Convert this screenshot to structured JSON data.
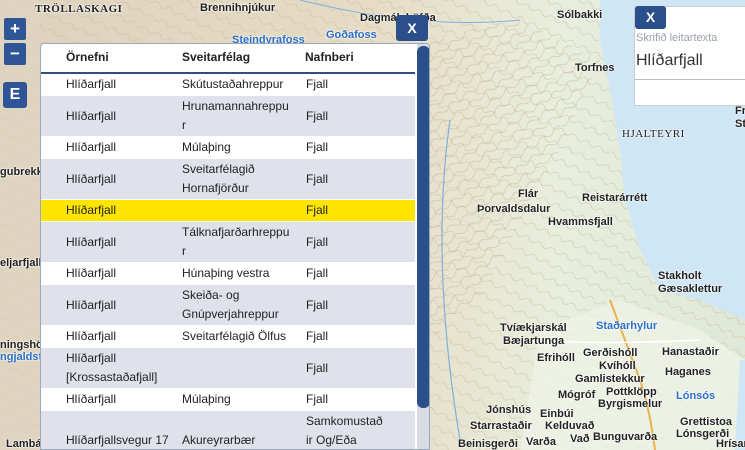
{
  "map": {
    "places": [
      {
        "name": "TRÖLLASKAGI",
        "style": "bold serif"
      },
      {
        "name": "Brennihnjúkur",
        "style": ""
      },
      {
        "name": "Dagmálahöfða",
        "style": ""
      },
      {
        "name": "Goðafoss",
        "style": "water"
      },
      {
        "name": "Steindyrafoss",
        "style": "water"
      },
      {
        "name": "Sólbakki",
        "style": "bold"
      },
      {
        "name": "Torfnes",
        "style": "bold"
      },
      {
        "name": "HJALTEYRI",
        "style": "serif"
      },
      {
        "name": "Flár",
        "style": "bold"
      },
      {
        "name": "Þorvaldsdalur",
        "style": "bold"
      },
      {
        "name": "Reistarárrétt",
        "style": "bold"
      },
      {
        "name": "Hvammsfjall",
        "style": "bold"
      },
      {
        "name": "Stakholt",
        "style": "bold"
      },
      {
        "name": "Gæsaklettur",
        "style": "bold"
      },
      {
        "name": "Tvíækjarskál",
        "style": "bold"
      },
      {
        "name": "Bæjartunga",
        "style": "bold"
      },
      {
        "name": "Staðarhylur",
        "style": "water"
      },
      {
        "name": "Efrihóll",
        "style": "bold"
      },
      {
        "name": "Gerðishóll",
        "style": "bold"
      },
      {
        "name": "Hanastaðir",
        "style": "bold"
      },
      {
        "name": "Kvíhóll",
        "style": "bold"
      },
      {
        "name": "Gamlistekkur",
        "style": "bold"
      },
      {
        "name": "Haganes",
        "style": "bold"
      },
      {
        "name": "Pottklöpp",
        "style": "bold"
      },
      {
        "name": "Mógróf",
        "style": "bold"
      },
      {
        "name": "Byrgismelur",
        "style": "bold"
      },
      {
        "name": "Lónsós",
        "style": "water"
      },
      {
        "name": "Jónshús",
        "style": "bold"
      },
      {
        "name": "Einbúi",
        "style": "bold"
      },
      {
        "name": "Starrastaðir",
        "style": "bold"
      },
      {
        "name": "Kelduvað",
        "style": "bold"
      },
      {
        "name": "Grettistoa",
        "style": "bold"
      },
      {
        "name": "Lónsgerði",
        "style": "bold"
      },
      {
        "name": "Beinisgerði",
        "style": "bold"
      },
      {
        "name": "Varða",
        "style": "bold"
      },
      {
        "name": "Vað",
        "style": "bold"
      },
      {
        "name": "Bunguvarða",
        "style": "bold"
      },
      {
        "name": "Hrísar",
        "style": "bold"
      },
      {
        "name": "gubrekk",
        "style": "bold"
      },
      {
        "name": "eljarfjall",
        "style": "bold"
      },
      {
        "name": "ningshö",
        "style": "bold"
      },
      {
        "name": "ngjaldst",
        "style": "water"
      },
      {
        "name": "Lambá",
        "style": "bold"
      },
      {
        "name": "Fr",
        "style": "bold"
      },
      {
        "name": "St",
        "style": "bold"
      }
    ]
  },
  "controls": {
    "zoom_in": "+",
    "zoom_out": "−",
    "extent": "E"
  },
  "results": {
    "close_label": "X",
    "headers": [
      "Örnefni",
      "Sveitarfélag",
      "Nafnberi"
    ],
    "rows": [
      {
        "ornefni": "Hlíðarfjall",
        "sveitarfelag": "Skútustaðahreppur",
        "nafnberi": "Fjall"
      },
      {
        "ornefni": "Hlíðarfjall",
        "sveitarfelag": "Hrunamannahreppu\nr",
        "nafnberi": "Fjall"
      },
      {
        "ornefni": "Hlíðarfjall",
        "sveitarfelag": "Múlaþing",
        "nafnberi": "Fjall"
      },
      {
        "ornefni": "Hlíðarfjall",
        "sveitarfelag": "Sveitarfélagið\nHornafjörður",
        "nafnberi": "Fjall"
      },
      {
        "ornefni": "Hlíðarfjall",
        "sveitarfelag": "",
        "nafnberi": "Fjall",
        "highlighted": true
      },
      {
        "ornefni": "Hlíðarfjall",
        "sveitarfelag": "Tálknafjarðarhreppu\nr",
        "nafnberi": "Fjall"
      },
      {
        "ornefni": "Hlíðarfjall",
        "sveitarfelag": "Húnaþing vestra",
        "nafnberi": "Fjall"
      },
      {
        "ornefni": "Hlíðarfjall",
        "sveitarfelag": "Skeiða- og\nGnúpverjahreppur",
        "nafnberi": "Fjall"
      },
      {
        "ornefni": "Hlíðarfjall",
        "sveitarfelag": "Sveitarfélagið Ölfus",
        "nafnberi": "Fjall"
      },
      {
        "ornefni": "Hlíðarfjall\n[Krossastaðafjall]",
        "sveitarfelag": "",
        "nafnberi": "Fjall"
      },
      {
        "ornefni": "Hlíðarfjall",
        "sveitarfelag": "Múlaþing",
        "nafnberi": "Fjall"
      },
      {
        "ornefni": "Hlíðarfjallsvegur 17",
        "sveitarfelag": "Akureyrarbær",
        "nafnberi": "Samkomustað\nir Og/Eða\nAðstaða"
      }
    ]
  },
  "search": {
    "close_label": "X",
    "placeholder": "Skrifið leitartexta",
    "value": "Hlíðarfjall"
  },
  "colors": {
    "accent": "#2b4f8a",
    "highlight": "#fde500",
    "row_alt": "#dfe2ea"
  }
}
